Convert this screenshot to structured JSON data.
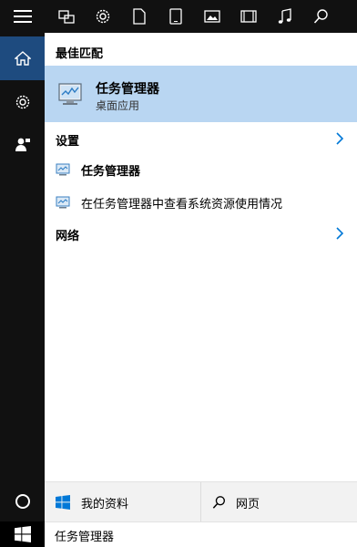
{
  "filter_bar": {
    "icons": [
      "apps-icon",
      "gear-icon",
      "document-icon",
      "tablet-icon",
      "photo-icon",
      "video-icon",
      "music-icon",
      "search-icon"
    ]
  },
  "results": {
    "best_match_label": "最佳匹配",
    "best_match": {
      "title": "任务管理器",
      "subtitle": "桌面应用"
    },
    "settings_label": "设置",
    "settings_items": [
      {
        "label": "任务管理器"
      },
      {
        "label": "在任务管理器中查看系统资源使用情况"
      }
    ],
    "web_label": "网络"
  },
  "bottom": {
    "my_stuff": "我的资料",
    "web": "网页"
  },
  "search": {
    "value": "任务管理器"
  },
  "colors": {
    "rail": "#111111",
    "home_active": "#1e4b7f",
    "highlight": "#b9d6f2",
    "accent": "#0078d7"
  }
}
